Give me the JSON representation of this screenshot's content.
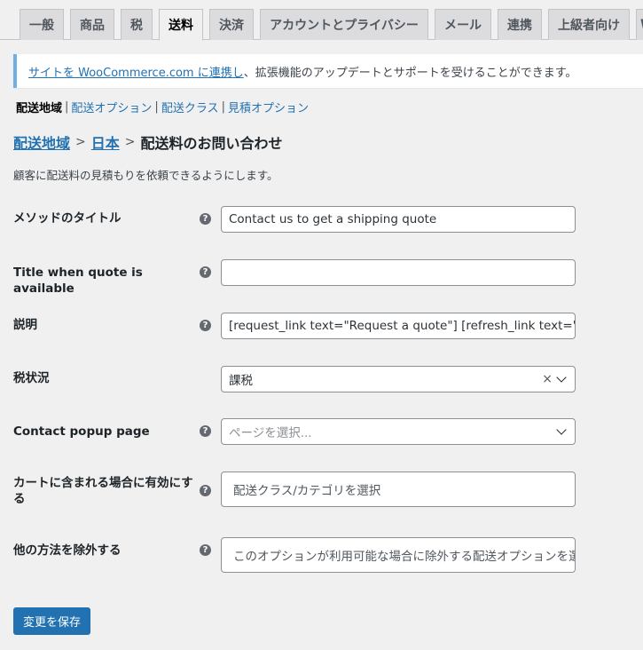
{
  "tabs": [
    "一般",
    "商品",
    "税",
    "送料",
    "決済",
    "アカウントとプライバシー",
    "メール",
    "連携",
    "上級者向け",
    "W"
  ],
  "notice": {
    "link_text": "サイトを WooCommerce.com に連携し",
    "rest_text": "、拡張機能のアップデートとサポートを受けることができます。"
  },
  "subnav": {
    "current": "配送地域",
    "links": [
      "配送オプション",
      "配送クラス",
      "見積オプション"
    ],
    "separator": "|"
  },
  "breadcrumb": {
    "zones": "配送地域",
    "zone": "日本",
    "method": "配送料のお問い合わせ",
    "separator": ">"
  },
  "description": "顧客に配送料の見積もりを依頼できるようにします。",
  "help_glyph": "?",
  "fields": {
    "method_title": {
      "label": "メソッドのタイトル",
      "value": "Contact us to get a shipping quote"
    },
    "quote_title": {
      "label": "Title when quote is available",
      "value": ""
    },
    "description": {
      "label": "説明",
      "value": "[request_link text=\"Request a quote\"] [refresh_link text=\"Refresh\"]"
    },
    "tax_status": {
      "label": "税状況",
      "value": "課税",
      "clear": "×"
    },
    "contact_page": {
      "label": "Contact popup page",
      "placeholder": "ページを選択..."
    },
    "enable_when": {
      "label": "カートに含まれる場合に有効にする",
      "placeholder": "配送クラス/カテゴリを選択"
    },
    "exclude_methods": {
      "label": "他の方法を除外する",
      "placeholder": "このオプションが利用可能な場合に除外する配送オプションを選択"
    }
  },
  "save_button": "変更を保存",
  "colors": {
    "accent": "#2271b1",
    "notice_border": "#72aee6"
  }
}
